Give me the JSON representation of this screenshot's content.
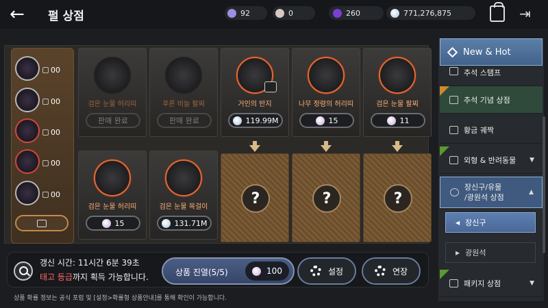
{
  "header": {
    "title": "펄 상점",
    "back_label": "←"
  },
  "currencies": [
    {
      "name": "energy",
      "value": "92",
      "color": "#9c8ee0"
    },
    {
      "name": "pearl-fragment",
      "value": "0",
      "color": "#d9c7c2"
    },
    {
      "name": "pearl",
      "value": "260",
      "color": "#7a3fd1"
    },
    {
      "name": "silver",
      "value": "771,276,875",
      "color": "#a9c1dc"
    }
  ],
  "left_slots": [
    {
      "qty": "00"
    },
    {
      "qty": "00"
    },
    {
      "qty": "00"
    },
    {
      "qty": "00"
    },
    {
      "qty": "00"
    }
  ],
  "cards_top": [
    {
      "name": "검은 눈물 허리띠",
      "price": "판매 완료",
      "sold": true
    },
    {
      "name": "푸른 비늘 팔찌",
      "price": "판매 완료",
      "sold": true
    },
    {
      "name": "거인의 반지",
      "price": "119.99M",
      "sold": false,
      "currency": "silver"
    },
    {
      "name": "나무 정령의 허리띠",
      "price": "15",
      "sold": false,
      "currency": "pearl"
    },
    {
      "name": "검은 눈물 팔찌",
      "price": "11",
      "sold": false,
      "currency": "pearl"
    }
  ],
  "cards_bottom": [
    {
      "name": "검은 눈물 허리띠",
      "price": "15",
      "currency": "pearl"
    },
    {
      "name": "검은 눈물 목걸이",
      "price": "131.71M",
      "currency": "silver"
    }
  ],
  "mystery_mark": "?",
  "bottom": {
    "refresh_label": "갱신 시간: 11시간 6분 39초",
    "grade_highlight": "태고 등급",
    "grade_rest": "까지 획득 가능합니다.",
    "display_label": "상품 진열(5/5)",
    "display_cost": "100",
    "settings_label": "설정",
    "extend_label": "연장",
    "notice": "상품 확률 정보는 공식 포럼 및 [설정>확률형 상품안내]를 통해 확인이 가능합니다."
  },
  "sidebar": {
    "new_hot": "New & Hot",
    "items": [
      {
        "label": "추석 스탬프"
      },
      {
        "label": "추석 기념 상점"
      },
      {
        "label": "황금 궤짝"
      },
      {
        "label": "외형 & 반려동물"
      },
      {
        "label": "장신구/유물\n/광원석 상점"
      },
      {
        "label": "패키지 상점"
      }
    ],
    "sub_items": [
      {
        "label": "장신구"
      },
      {
        "label": "광원석"
      }
    ]
  }
}
